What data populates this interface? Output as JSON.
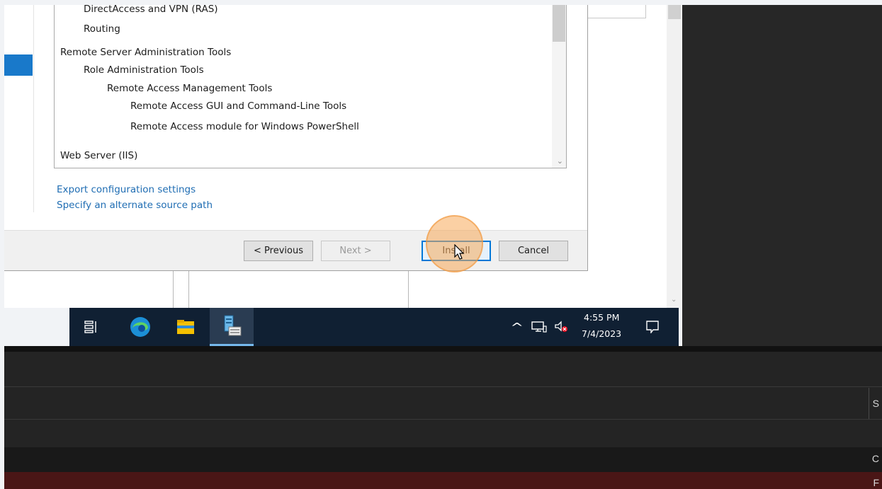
{
  "wizard": {
    "features": [
      {
        "label": "DirectAccess and VPN (RAS)",
        "indent": 1
      },
      {
        "label": "Routing",
        "indent": 1
      },
      {
        "label": "Remote Server Administration Tools",
        "indent": 0
      },
      {
        "label": "Role Administration Tools",
        "indent": 1
      },
      {
        "label": "Remote Access Management Tools",
        "indent": 2
      },
      {
        "label": "Remote Access GUI and Command-Line Tools",
        "indent": 3
      },
      {
        "label": "Remote Access module for Windows PowerShell",
        "indent": 3
      },
      {
        "label": "Web Server (IIS)",
        "indent": 0
      }
    ],
    "links": {
      "export": "Export configuration settings",
      "alternate_source": "Specify an alternate source path"
    },
    "buttons": {
      "previous": "< Previous",
      "next": "Next >",
      "install": "Install",
      "cancel": "Cancel"
    }
  },
  "taskbar": {
    "icons": [
      "task-view-icon",
      "edge-icon",
      "file-explorer-icon",
      "server-manager-icon"
    ],
    "tray": {
      "overflow": "^",
      "time": "4:55 PM",
      "date": "7/4/2023"
    }
  },
  "lower_panel": {
    "edge_letters": [
      "S",
      "C",
      "F"
    ]
  },
  "colors": {
    "accent": "#0078d7",
    "selection_blue": "#1979ca",
    "link": "#1f6db3",
    "taskbar": "#102033",
    "click_highlight": "#f7aa5a",
    "lower_red_row": "#4a1616"
  }
}
